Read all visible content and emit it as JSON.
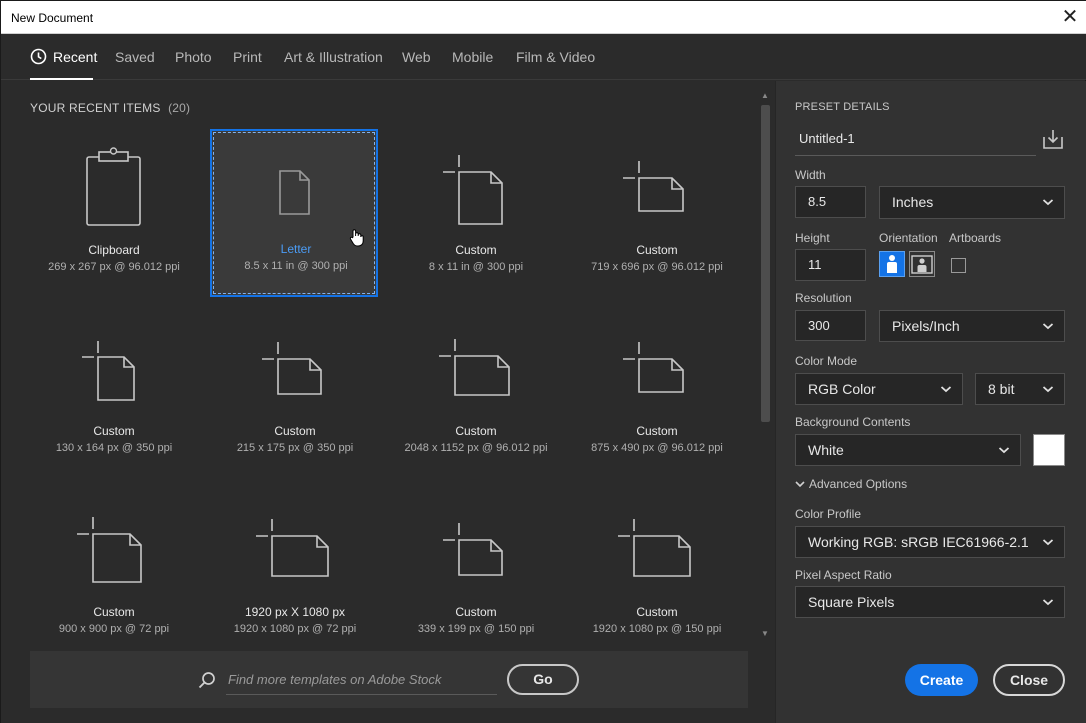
{
  "window": {
    "title": "New Document",
    "close_label": "✕"
  },
  "tabs": [
    {
      "label": "Recent"
    },
    {
      "label": "Saved"
    },
    {
      "label": "Photo"
    },
    {
      "label": "Print"
    },
    {
      "label": "Art & Illustration"
    },
    {
      "label": "Web"
    },
    {
      "label": "Mobile"
    },
    {
      "label": "Film & Video"
    }
  ],
  "recent": {
    "heading": "YOUR RECENT ITEMS",
    "count": "(20)",
    "items": [
      {
        "name": "Clipboard",
        "dims": "269 x 267 px @ 96.012 ppi",
        "icon": "clipboard-icon"
      },
      {
        "name": "Letter",
        "dims": "8.5 x 11 in @ 300 ppi",
        "icon": "document-portrait-icon"
      },
      {
        "name": "Custom",
        "dims": "8 x 11 in @ 300 ppi",
        "icon": "custom-portrait-icon"
      },
      {
        "name": "Custom",
        "dims": "719 x 696 px @ 96.012 ppi",
        "icon": "custom-landscape-icon"
      },
      {
        "name": "Custom",
        "dims": "130 x 164 px @ 350 ppi",
        "icon": "custom-portrait-icon"
      },
      {
        "name": "Custom",
        "dims": "215 x 175 px @ 350 ppi",
        "icon": "custom-landscape-icon"
      },
      {
        "name": "Custom",
        "dims": "2048 x 1152 px @ 96.012 ppi",
        "icon": "custom-landscape-icon"
      },
      {
        "name": "Custom",
        "dims": "875 x 490 px @ 96.012 ppi",
        "icon": "custom-landscape-icon"
      },
      {
        "name": "Custom",
        "dims": "900 x 900 px @ 72 ppi",
        "icon": "custom-square-icon"
      },
      {
        "name": "1920 px X 1080 px",
        "dims": "1920 x 1080 px @ 72 ppi",
        "icon": "custom-landscape-icon"
      },
      {
        "name": "Custom",
        "dims": "339 x 199 px @ 150 ppi",
        "icon": "custom-landscape-icon"
      },
      {
        "name": "Custom",
        "dims": "1920 x 1080 px @ 150 ppi",
        "icon": "custom-landscape-icon"
      }
    ]
  },
  "search": {
    "placeholder": "Find more templates on Adobe Stock",
    "go_label": "Go"
  },
  "preset": {
    "heading": "PRESET DETAILS",
    "name": "Untitled-1",
    "width_label": "Width",
    "width_value": "8.5",
    "width_unit": "Inches",
    "height_label": "Height",
    "height_value": "11",
    "orientation_label": "Orientation",
    "artboards_label": "Artboards",
    "resolution_label": "Resolution",
    "resolution_value": "300",
    "resolution_unit": "Pixels/Inch",
    "color_mode_label": "Color Mode",
    "color_mode": "RGB Color",
    "bit_depth": "8 bit",
    "background_label": "Background Contents",
    "background": "White",
    "background_color": "#ffffff",
    "advanced_label": "Advanced Options",
    "color_profile_label": "Color Profile",
    "color_profile": "Working RGB: sRGB IEC61966-2.1",
    "pixel_aspect_label": "Pixel Aspect Ratio",
    "pixel_aspect": "Square Pixels"
  },
  "actions": {
    "create_label": "Create",
    "close_label": "Close"
  },
  "colors": {
    "accent": "#1473e6",
    "selected_text": "#4b9cf5"
  }
}
